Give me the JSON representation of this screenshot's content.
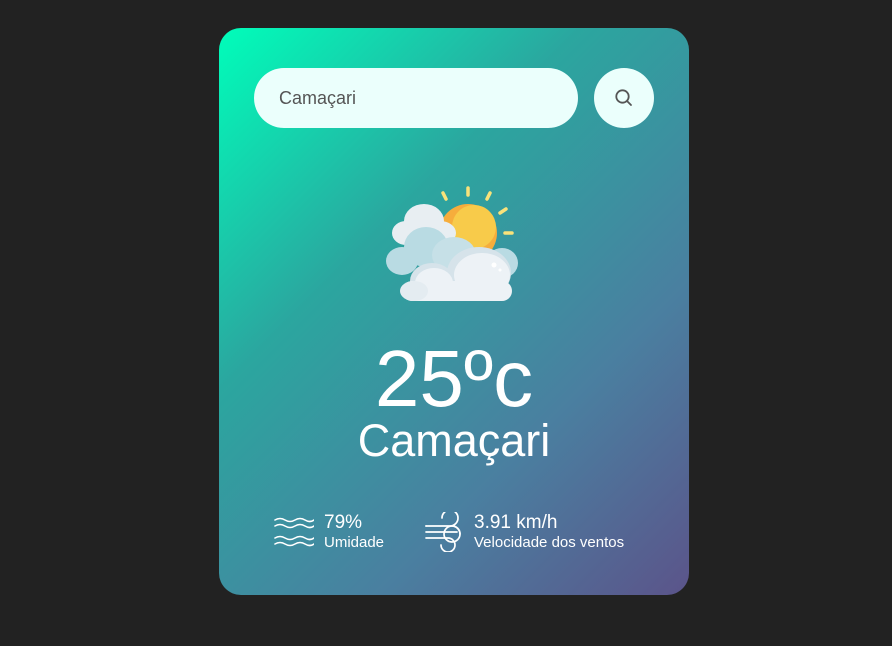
{
  "search": {
    "value": "Camaçari",
    "placeholder": "",
    "button_icon": "search-icon"
  },
  "weather": {
    "icon": "partly-cloudy-sun-icon",
    "temperature": "25ºc",
    "city": "Camaçari"
  },
  "details": {
    "humidity": {
      "icon": "humidity-waves-icon",
      "value": "79%",
      "label": "Umidade"
    },
    "wind": {
      "icon": "wind-icon",
      "value": "3.91 km/h",
      "label": "Velocidade dos ventos"
    }
  },
  "colors": {
    "background": "#222222",
    "gradient_start": "#00feba",
    "gradient_end": "#5b548a",
    "input_background": "#ebfffc",
    "text": "#ffffff"
  }
}
